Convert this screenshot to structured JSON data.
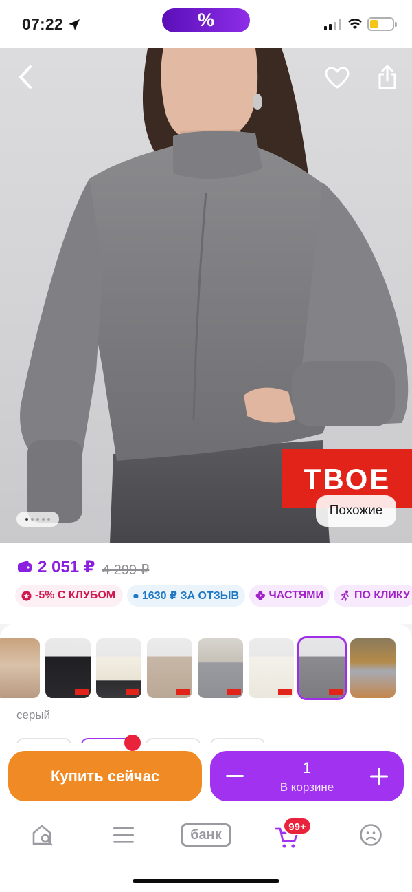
{
  "status_bar": {
    "time": "07:22",
    "promo_badge": "%"
  },
  "hero": {
    "similar_label": "Похожие",
    "brand_logo_text": "ТВОЕ",
    "photo_dots": 5,
    "photo_active_index": 0
  },
  "price": {
    "current": "2 051 ₽",
    "old": "4 299 ₽",
    "accent_color": "#8b1fe0"
  },
  "chips": [
    {
      "icon": "club-star-icon",
      "label": "-5% С КЛУБОМ"
    },
    {
      "icon": "wallet-icon",
      "label": "1630 ₽ ЗА ОТЗЫВ"
    },
    {
      "icon": "clover-icon",
      "label": "ЧАСТЯМИ"
    },
    {
      "icon": "running-person-icon",
      "label": "ПО КЛИКУ"
    }
  ],
  "colors": {
    "selected_name": "серый",
    "selected_index": 6,
    "swatch_count": 8
  },
  "buy": {
    "buy_now_label": "Купить сейчас",
    "quantity": "1",
    "in_cart_label": "В корзине",
    "buy_color": "#f08a24",
    "cart_color": "#a133f0"
  },
  "tab_bar": {
    "items": [
      {
        "icon": "home-search-icon"
      },
      {
        "icon": "catalog-menu-icon"
      },
      {
        "icon": "bank-icon",
        "label": "банк"
      },
      {
        "icon": "cart-icon",
        "badge": "99+"
      },
      {
        "icon": "profile-icon"
      }
    ]
  }
}
